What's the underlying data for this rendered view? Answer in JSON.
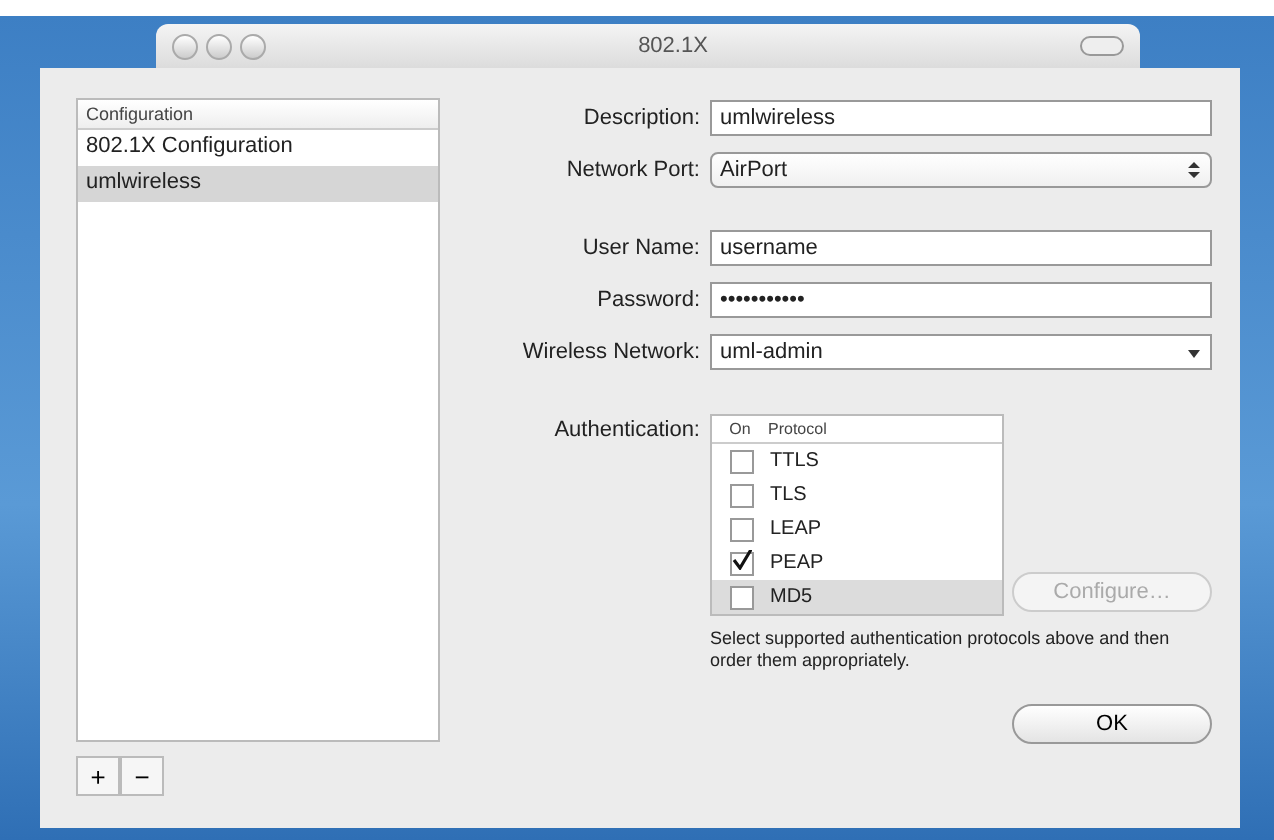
{
  "window": {
    "title": "802.1X"
  },
  "configuration_list": {
    "header": "Configuration",
    "items": [
      {
        "label": "802.1X Configuration",
        "selected": false
      },
      {
        "label": "umlwireless",
        "selected": true
      }
    ]
  },
  "list_buttons": [
    {
      "label": "+"
    },
    {
      "label": "−"
    }
  ],
  "form": [
    {
      "label": "Description:",
      "kind": "text",
      "value": "umlwireless"
    },
    {
      "label": "Network Port:",
      "kind": "popup",
      "value": "AirPort"
    },
    {
      "label": "User Name:",
      "kind": "text",
      "value": "username"
    },
    {
      "label": "Password:",
      "kind": "text",
      "value": "•••••••••••"
    },
    {
      "label": "Wireless Network:",
      "kind": "combo",
      "value": "uml-admin"
    }
  ],
  "authentication": {
    "label": "Authentication:",
    "columns": [
      "On",
      "Protocol"
    ],
    "protocols": [
      {
        "name": "TTLS",
        "on": false,
        "selected": false
      },
      {
        "name": "TLS",
        "on": false,
        "selected": false
      },
      {
        "name": "LEAP",
        "on": false,
        "selected": false
      },
      {
        "name": "PEAP",
        "on": true,
        "selected": false
      },
      {
        "name": "MD5",
        "on": false,
        "selected": true
      }
    ]
  },
  "configure_button": {
    "label": "Configure…",
    "disabled": true
  },
  "help_text": "Select supported authentication protocols above and then order them appropriately.",
  "ok_button": {
    "label": "OK"
  }
}
